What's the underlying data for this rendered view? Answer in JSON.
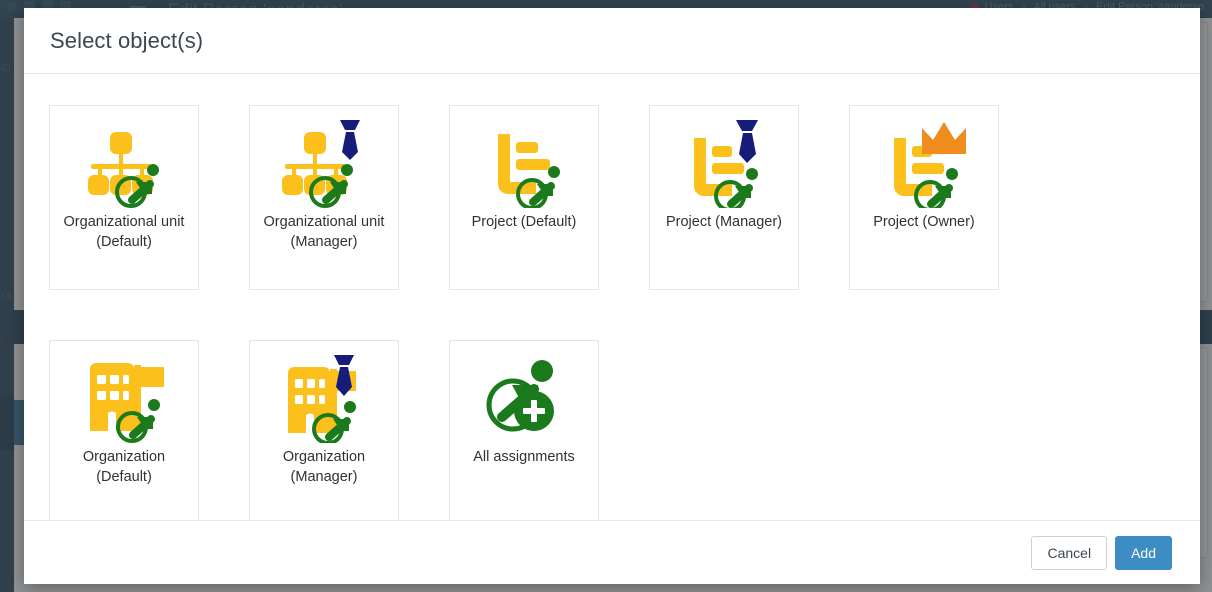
{
  "background": {
    "page_title": "Edit Person 'aanderso'",
    "breadcrumb": {
      "items": [
        "Users",
        "All users",
        "Edit Person 'aanderso"
      ],
      "separator": ">"
    },
    "labels": {
      "left_o": "O",
      "left_ss": "ss",
      "check": "✓"
    }
  },
  "modal": {
    "title": "Select object(s)",
    "cards": [
      {
        "id": "organizational-unit-default",
        "label": "Organizational unit (Default)",
        "icon": "org-unit-icon",
        "badges": []
      },
      {
        "id": "organizational-unit-manager",
        "label": "Organizational unit (Manager)",
        "icon": "org-unit-icon",
        "badges": [
          "tie"
        ]
      },
      {
        "id": "project-default",
        "label": "Project (Default)",
        "icon": "project-icon",
        "badges": []
      },
      {
        "id": "project-manager",
        "label": "Project (Manager)",
        "icon": "project-icon",
        "badges": [
          "tie"
        ]
      },
      {
        "id": "project-owner",
        "label": "Project (Owner)",
        "icon": "project-icon",
        "badges": [
          "crown"
        ]
      },
      {
        "id": "organization-default",
        "label": "Organization (Default)",
        "icon": "organization-icon",
        "badges": []
      },
      {
        "id": "organization-manager",
        "label": "Organization (Manager)",
        "icon": "organization-icon",
        "badges": [
          "tie"
        ]
      },
      {
        "id": "all-assignments",
        "label": "All assignments",
        "icon": "all-assignments-icon",
        "badges": []
      }
    ],
    "footer": {
      "cancel_label": "Cancel",
      "add_label": "Add"
    }
  },
  "colors": {
    "yellow": "#FCC01C",
    "green": "#1B7A1B",
    "navy": "#161C7A",
    "orange": "#F08C1E",
    "primary_button": "#3d8dc4",
    "header_bar": "#22485e",
    "sidebar": "#1f4257"
  }
}
